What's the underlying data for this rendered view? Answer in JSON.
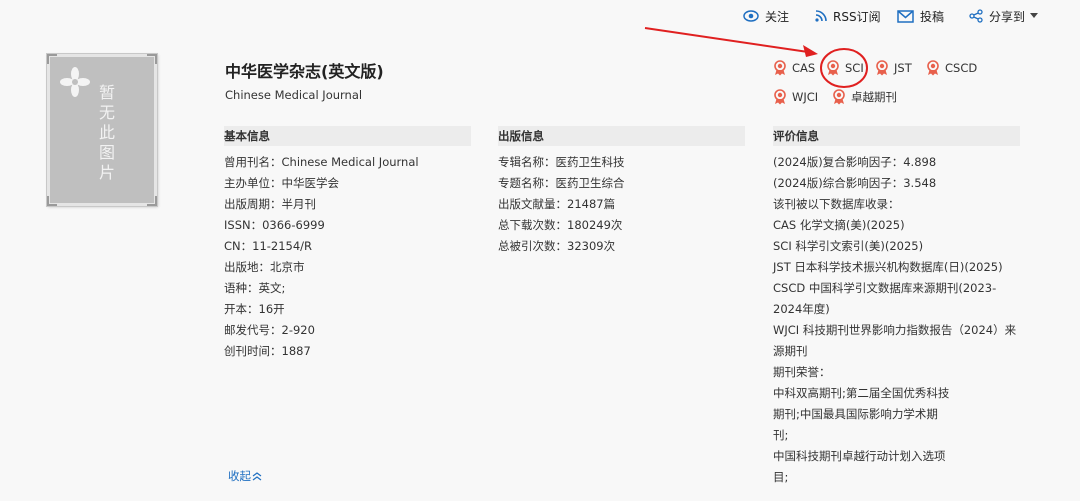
{
  "topbar": {
    "follow_label": "关注",
    "rss_label": "RSS订阅",
    "submit_label": "投稿",
    "share_label": "分享到"
  },
  "cover": {
    "placeholder_chars": [
      "暂",
      "无",
      "此",
      "图",
      "片"
    ]
  },
  "journal": {
    "title": "中华医学杂志(英文版)",
    "subtitle": "Chinese Medical Journal"
  },
  "badges": [
    {
      "label": "CAS"
    },
    {
      "label": "SCI"
    },
    {
      "label": "JST"
    },
    {
      "label": "CSCD"
    },
    {
      "label": "WJCI"
    },
    {
      "label": "卓越期刊"
    }
  ],
  "basic_info": {
    "heading": "基本信息",
    "rows": [
      "曾用刊名：Chinese Medical Journal",
      "主办单位：中华医学会",
      "出版周期：半月刊",
      "ISSN：0366-6999",
      "CN：11-2154/R",
      "出版地：北京市",
      "语种：英文;",
      "开本：16开",
      "邮发代号：2-920",
      "创刊时间：1887"
    ]
  },
  "pub_info": {
    "heading": "出版信息",
    "rows": [
      "专辑名称：医药卫生科技",
      "专题名称：医药卫生综合",
      "出版文献量：21487篇",
      "总下载次数：180249次",
      "总被引次数：32309次"
    ]
  },
  "eval_info": {
    "heading": "评价信息",
    "rows": [
      "(2024版)复合影响因子：4.898",
      "(2024版)综合影响因子：3.548",
      "该刊被以下数据库收录：",
      "CAS 化学文摘(美)(2025)",
      "SCI 科学引文索引(美)(2025)",
      "JST 日本科学技术振兴机构数据库(日)(2025)",
      "CSCD 中国科学引文数据库来源期刊(2023-2024年度)",
      "WJCI 科技期刊世界影响力指数报告（2024）来源期刊",
      "期刊荣誉：",
      "中科双高期刊;第二届全国优秀科技期刊;中国最具国际影响力学术期刊;",
      "中国科技期刊卓越行动计划入选项目;"
    ]
  },
  "collapse_label": "收起",
  "colors": {
    "badge": "#e8604c",
    "link": "#1f6fc1",
    "annotation": "#e02020",
    "icon_blue": "#1f6fc1"
  }
}
